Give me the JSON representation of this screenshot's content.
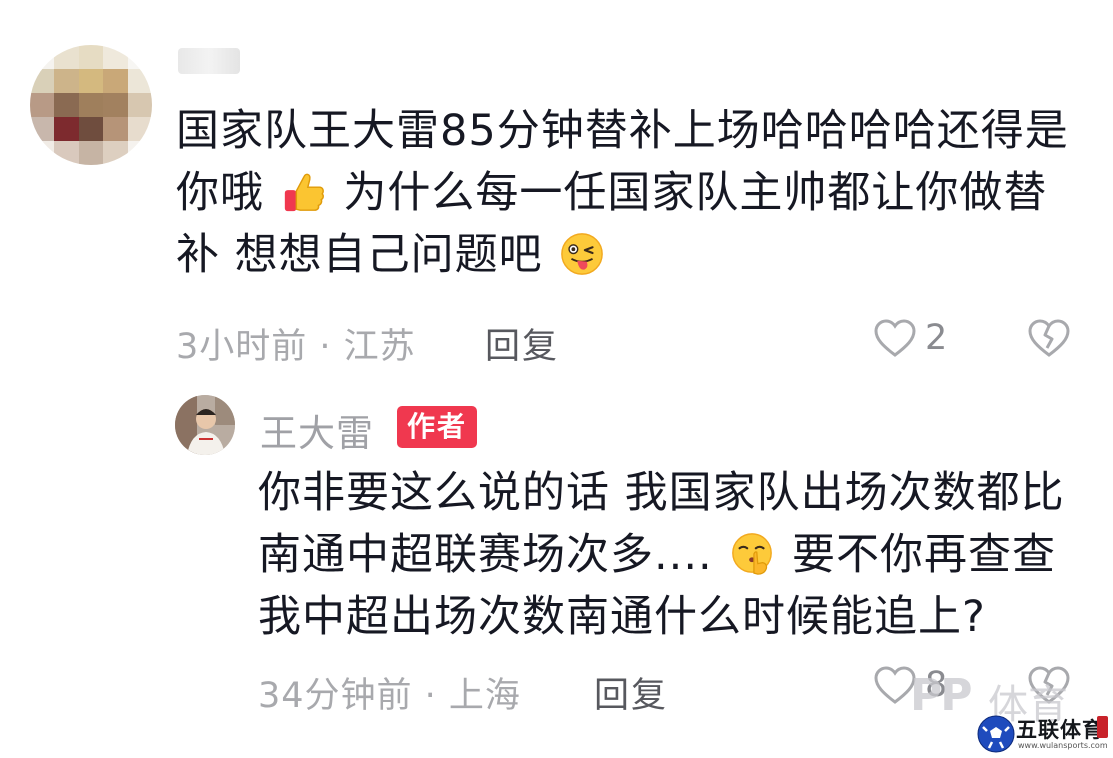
{
  "comment": {
    "avatar_icon": "blurred-avatar",
    "username": "",
    "text_part1": "国家队王大雷85分钟替补上场哈哈哈哈还得是你哦",
    "emoji1": "thumbs-up-icon",
    "text_part2": "为什么每一任国家队主帅都让你做替补 想想自己问题吧",
    "emoji2": "tongue-wink-icon",
    "time_location": "3小时前 · 江苏",
    "reply_label": "回复",
    "like_count": "2"
  },
  "reply": {
    "author_name": "王大雷",
    "author_badge": "作者",
    "text_part1": "你非要这么说的话 我国家队出场次数都比南通中超联赛场次多....",
    "emoji": "shushing-face-icon",
    "text_part2": "要不你再查查我中超出场次数南通什么时候能追上?",
    "time_location": "34分钟前 · 上海",
    "reply_label": "回复",
    "like_count": "8"
  },
  "watermarks": {
    "pp_logo": "PP",
    "pp_text": "体育",
    "site_name": "五联体育",
    "site_url": "www.wulansports.com"
  },
  "colors": {
    "text_primary": "#161823",
    "text_meta": "#a8a9ad",
    "badge_bg": "#f0384f"
  }
}
